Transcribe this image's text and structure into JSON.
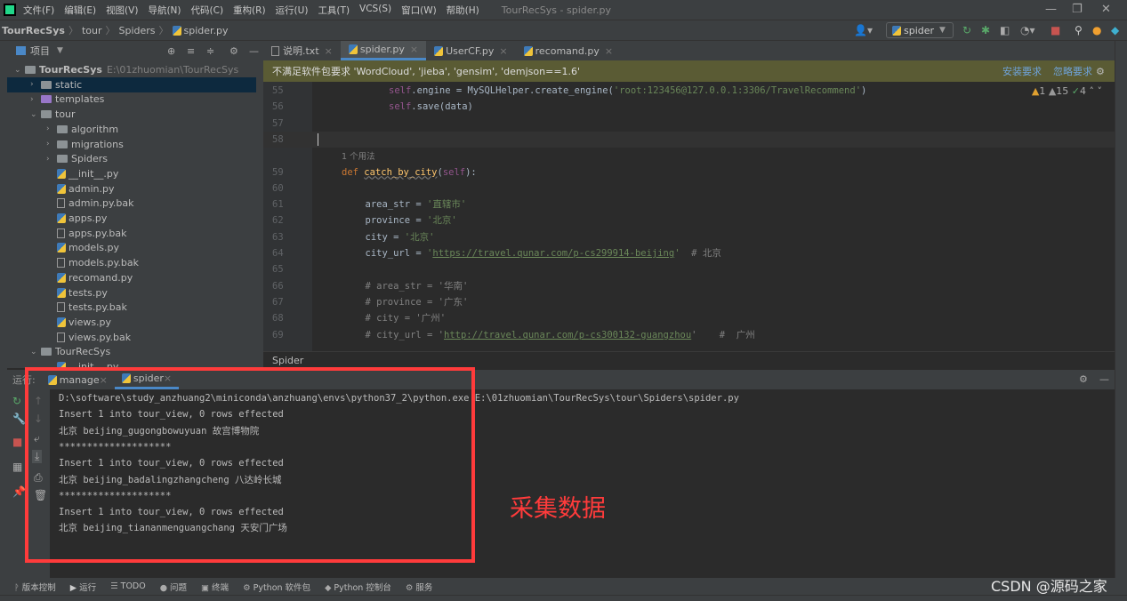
{
  "menu": {
    "items": [
      "文件(F)",
      "编辑(E)",
      "视图(V)",
      "导航(N)",
      "代码(C)",
      "重构(R)",
      "运行(U)",
      "工具(T)",
      "VCS(S)",
      "窗口(W)",
      "帮助(H)"
    ],
    "window_title": "TourRecSys - spider.py"
  },
  "breadcrumb": [
    "TourRecSys",
    "tour",
    "Spiders",
    "spider.py"
  ],
  "toolbar": {
    "run_config": "spider"
  },
  "project": {
    "title": "项目",
    "items": [
      {
        "label": "TourRecSys",
        "hint": "E:\\01zhuomian\\TourRecSys",
        "depth": 0,
        "kind": "folder",
        "open": true
      },
      {
        "label": "static",
        "depth": 1,
        "kind": "folder",
        "open": false,
        "selected": true
      },
      {
        "label": "templates",
        "depth": 1,
        "kind": "folder-purple",
        "open": false
      },
      {
        "label": "tour",
        "depth": 1,
        "kind": "folder",
        "open": true
      },
      {
        "label": "algorithm",
        "depth": 2,
        "kind": "folder",
        "open": false
      },
      {
        "label": "migrations",
        "depth": 2,
        "kind": "folder",
        "open": false
      },
      {
        "label": "Spiders",
        "depth": 2,
        "kind": "folder",
        "open": false
      },
      {
        "label": "__init__.py",
        "depth": 2,
        "kind": "py"
      },
      {
        "label": "admin.py",
        "depth": 2,
        "kind": "py"
      },
      {
        "label": "admin.py.bak",
        "depth": 2,
        "kind": "file"
      },
      {
        "label": "apps.py",
        "depth": 2,
        "kind": "py"
      },
      {
        "label": "apps.py.bak",
        "depth": 2,
        "kind": "file"
      },
      {
        "label": "models.py",
        "depth": 2,
        "kind": "py"
      },
      {
        "label": "models.py.bak",
        "depth": 2,
        "kind": "file"
      },
      {
        "label": "recomand.py",
        "depth": 2,
        "kind": "py"
      },
      {
        "label": "tests.py",
        "depth": 2,
        "kind": "py"
      },
      {
        "label": "tests.py.bak",
        "depth": 2,
        "kind": "file"
      },
      {
        "label": "views.py",
        "depth": 2,
        "kind": "py"
      },
      {
        "label": "views.py.bak",
        "depth": 2,
        "kind": "file"
      },
      {
        "label": "TourRecSys",
        "depth": 1,
        "kind": "folder",
        "open": true
      },
      {
        "label": "__init__.py",
        "depth": 2,
        "kind": "py"
      }
    ]
  },
  "tabs": [
    {
      "label": "说明.txt",
      "kind": "file"
    },
    {
      "label": "spider.py",
      "kind": "py",
      "active": true
    },
    {
      "label": "UserCF.py",
      "kind": "py"
    },
    {
      "label": "recomand.py",
      "kind": "py"
    }
  ],
  "banner": {
    "text": "不满足软件包要求 'WordCloud', 'jieba', 'gensim', 'demjson==1.6'",
    "install": "安装要求",
    "ignore": "忽略要求"
  },
  "inspections": {
    "errors": "1",
    "warnings": "15",
    "ok": "4"
  },
  "editor": {
    "usage_hint": "1 个用法",
    "lines": [
      {
        "n": "55",
        "indent": 2,
        "t": [
          [
            "self",
            "self"
          ],
          [
            "id",
            ".engine = MySQLHelper.create_engine("
          ],
          [
            "str",
            "'root:123456@127.0.0.1:3306/TravelRecommend'"
          ],
          [
            "id",
            ")"
          ]
        ]
      },
      {
        "n": "56",
        "indent": 2,
        "t": [
          [
            "self",
            "self"
          ],
          [
            "id",
            ".save(data)"
          ]
        ]
      },
      {
        "n": "57",
        "indent": 0,
        "t": []
      },
      {
        "n": "58",
        "indent": 0,
        "t": [],
        "current": true
      },
      {
        "n": "59",
        "indent": 0,
        "t": [
          [
            "kw",
            "def "
          ],
          [
            "fn",
            "catch_by_city"
          ],
          [
            "id",
            "("
          ],
          [
            "self",
            "self"
          ],
          [
            "id",
            "):"
          ]
        ],
        "usage": true
      },
      {
        "n": "60",
        "indent": 0,
        "t": []
      },
      {
        "n": "61",
        "indent": 1,
        "t": [
          [
            "id",
            "area_str = "
          ],
          [
            "str",
            "'直辖市'"
          ]
        ]
      },
      {
        "n": "62",
        "indent": 1,
        "t": [
          [
            "id",
            "province = "
          ],
          [
            "str",
            "'北京'"
          ]
        ]
      },
      {
        "n": "63",
        "indent": 1,
        "t": [
          [
            "id",
            "city = "
          ],
          [
            "str",
            "'北京'"
          ]
        ]
      },
      {
        "n": "64",
        "indent": 1,
        "t": [
          [
            "id",
            "city_url = "
          ],
          [
            "str",
            "'"
          ],
          [
            "url",
            "https://travel.qunar.com/p-cs299914-beijing"
          ],
          [
            "str",
            "'"
          ],
          [
            "cm",
            "  # 北京"
          ]
        ]
      },
      {
        "n": "65",
        "indent": 0,
        "t": []
      },
      {
        "n": "66",
        "indent": 1,
        "t": [
          [
            "cm",
            "# area_str = '华南'"
          ]
        ]
      },
      {
        "n": "67",
        "indent": 1,
        "t": [
          [
            "cm",
            "# province = '广东'"
          ]
        ]
      },
      {
        "n": "68",
        "indent": 1,
        "t": [
          [
            "cm",
            "# city = '广州'"
          ]
        ]
      },
      {
        "n": "69",
        "indent": 1,
        "t": [
          [
            "cm",
            "# city_url = '"
          ],
          [
            "url",
            "http://travel.qunar.com/p-cs300132-guangzhou"
          ],
          [
            "cm",
            "'    #  广州"
          ]
        ]
      }
    ]
  },
  "editor_breadcrumb": "Spider",
  "run": {
    "label": "运行:",
    "tabs": [
      {
        "label": "manage"
      },
      {
        "label": "spider",
        "active": true
      }
    ],
    "output": [
      "D:\\software\\study_anzhuang2\\miniconda\\anzhuang\\envs\\python37_2\\python.exe E:\\01zhuomian\\TourRecSys\\tour\\Spiders\\spider.py",
      "Insert 1 into tour_view, 0 rows effected",
      "北京 beijing_gugongbowuyuan 故宫博物院",
      "********************",
      "Insert 1 into tour_view, 0 rows effected",
      "北京 beijing_badalingzhangcheng 八达岭长城",
      "********************",
      "Insert 1 into tour_view, 0 rows effected",
      "北京 beijing_tiananmenguangchang 天安门广场"
    ]
  },
  "annotation": "采集数据",
  "bottom_tools": [
    "版本控制",
    "运行",
    "TODO",
    "问题",
    "终端",
    "Python 软件包",
    "Python 控制台",
    "服务"
  ],
  "watermark": "CSDN @源码之家",
  "colors": {
    "annotation": "#ff3b3b",
    "accent": "#4a88c7",
    "banner": "#5a5b34"
  }
}
